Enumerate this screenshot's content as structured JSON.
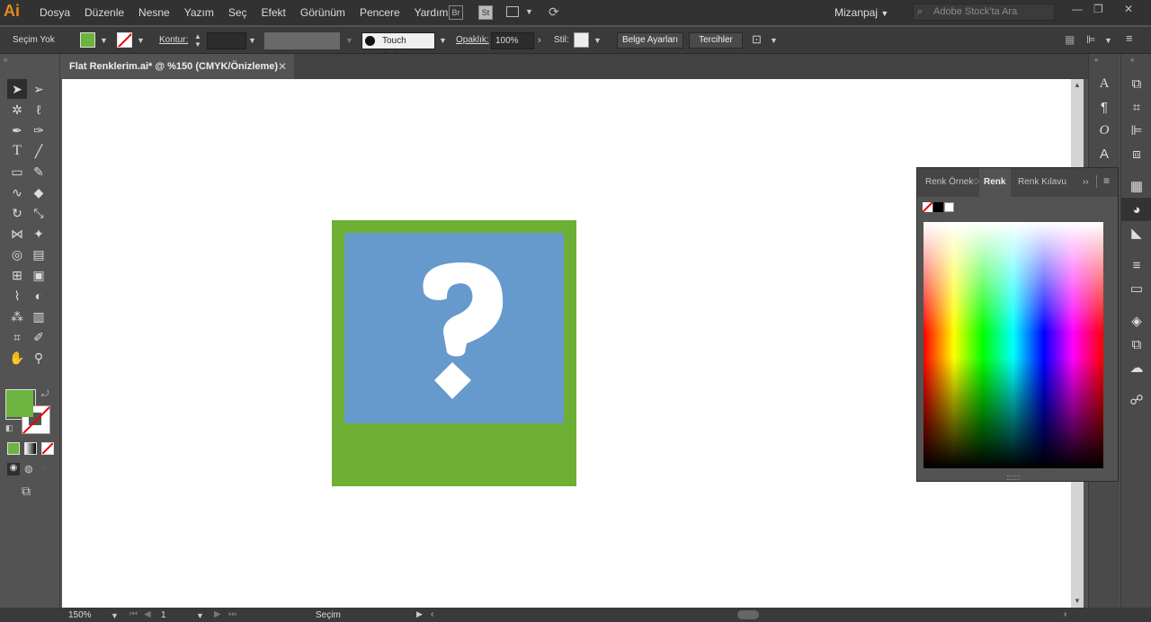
{
  "menu": {
    "logo": "Ai",
    "items": [
      "Dosya",
      "Düzenle",
      "Nesne",
      "Yazım",
      "Seç",
      "Efekt",
      "Görünüm",
      "Pencere",
      "Yardım"
    ],
    "bridge": "Br",
    "stock": "St",
    "workspace": "Mizanpaj",
    "search_placeholder": "Adobe Stock'ta Ara"
  },
  "control": {
    "selection_label": "Seçim Yok",
    "stroke_label": "Kontur:",
    "brush": "Touch Callig...",
    "opacity_label": "Opaklık:",
    "opacity_value": "100%",
    "style_label": "Stil:",
    "doc_settings": "Belge Ayarları",
    "preferences": "Tercihler"
  },
  "document": {
    "tab_title": "Flat Renklerim.ai* @ %150 (CMYK/Önizleme)",
    "close": "✕"
  },
  "colors": {
    "fill": "#6db33f",
    "artwork_frame": "#6db033",
    "artwork_blue": "#6699cc",
    "glyph": "#ffffff"
  },
  "color_panel": {
    "tabs": [
      "Renk Örnek",
      "Renk",
      "Renk Kılavu"
    ]
  },
  "status": {
    "zoom": "150%",
    "page": "1",
    "tool": "Seçim"
  }
}
